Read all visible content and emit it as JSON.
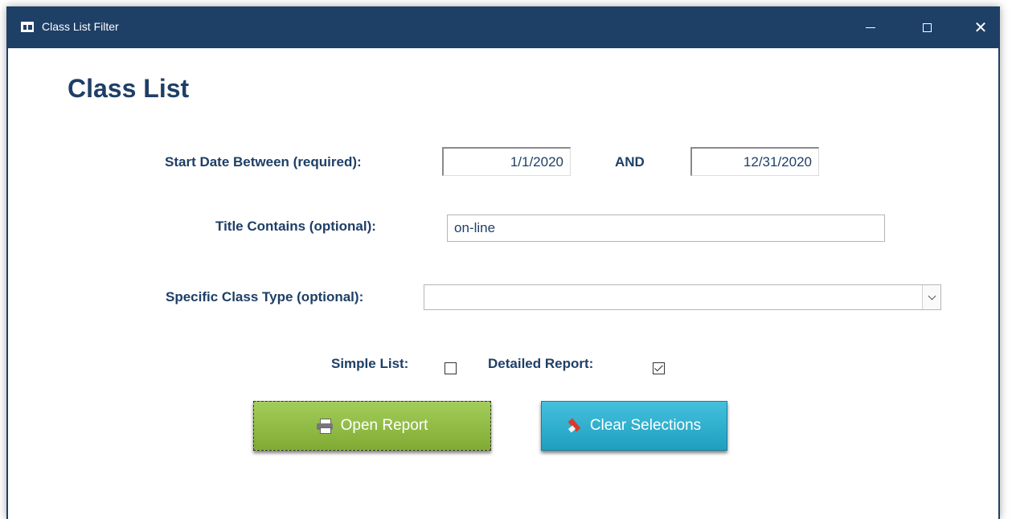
{
  "window": {
    "title": "Class List Filter"
  },
  "form": {
    "heading": "Class List",
    "start_date_label": "Start Date Between (required):",
    "start_date_from": "1/1/2020",
    "and_label": "AND",
    "start_date_to": "12/31/2020",
    "title_label": "Title Contains (optional):",
    "title_value": "on-line",
    "class_type_label": "Specific Class Type (optional):",
    "class_type_value": "",
    "simple_list_label": "Simple List:",
    "simple_list_checked": false,
    "detailed_report_label": "Detailed Report:",
    "detailed_report_checked": true
  },
  "buttons": {
    "open_report": "Open Report",
    "clear_selections": "Clear Selections"
  },
  "colors": {
    "titlebar": "#1e3f66",
    "label_text": "#1e3f66",
    "open_button": "#8dbb41",
    "clear_button": "#2fb0d0"
  },
  "icons": [
    "form-icon",
    "minimize-icon",
    "maximize-icon",
    "close-icon",
    "printer-icon",
    "eraser-icon",
    "chevron-down-icon",
    "checkmark-icon"
  ]
}
